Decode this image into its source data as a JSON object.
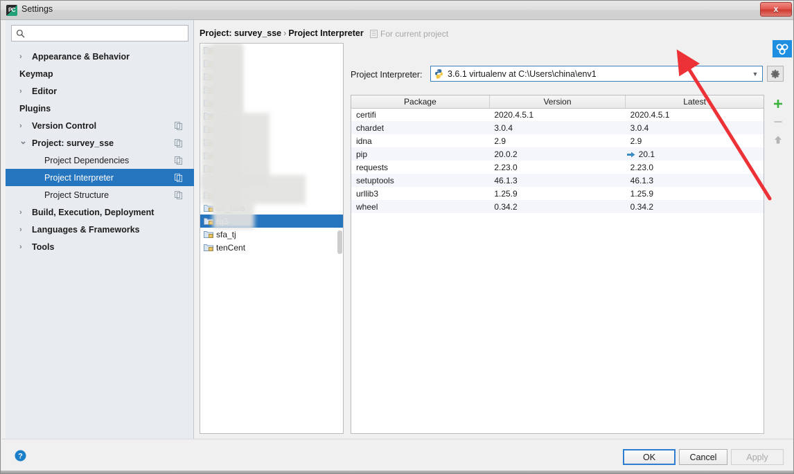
{
  "window": {
    "title": "Settings",
    "app_icon": "pycharm-icon",
    "close_label": "x"
  },
  "sidebar": {
    "search": {
      "value": "",
      "placeholder": ""
    },
    "items": [
      {
        "label": "Appearance & Behavior",
        "level": 0,
        "twisty": "collapsed",
        "copy": false,
        "selected": false
      },
      {
        "label": "Keymap",
        "level": 0,
        "twisty": "none",
        "copy": false,
        "selected": false
      },
      {
        "label": "Editor",
        "level": 0,
        "twisty": "collapsed",
        "copy": false,
        "selected": false
      },
      {
        "label": "Plugins",
        "level": 0,
        "twisty": "none",
        "copy": false,
        "selected": false
      },
      {
        "label": "Version Control",
        "level": 0,
        "twisty": "collapsed",
        "copy": true,
        "selected": false
      },
      {
        "label": "Project: survey_sse",
        "level": 0,
        "twisty": "expanded",
        "copy": true,
        "selected": false
      },
      {
        "label": "Project Dependencies",
        "level": 1,
        "twisty": "none",
        "copy": true,
        "selected": false
      },
      {
        "label": "Project Interpreter",
        "level": 1,
        "twisty": "none",
        "copy": true,
        "selected": true
      },
      {
        "label": "Project Structure",
        "level": 1,
        "twisty": "none",
        "copy": true,
        "selected": false
      },
      {
        "label": "Build, Execution, Deployment",
        "level": 0,
        "twisty": "collapsed",
        "copy": false,
        "selected": false
      },
      {
        "label": "Languages & Frameworks",
        "level": 0,
        "twisty": "collapsed",
        "copy": false,
        "selected": false
      },
      {
        "label": "Tools",
        "level": 0,
        "twisty": "collapsed",
        "copy": false,
        "selected": false
      }
    ]
  },
  "main": {
    "breadcrumb": {
      "root": "Project: survey_sse",
      "separator": "›",
      "leaf": "Project Interpreter"
    },
    "scope_note": {
      "icon": "document-icon",
      "text": "For current project"
    },
    "interpreter": {
      "label": "Project Interpreter:",
      "icon": "python-icon",
      "value": "3.6.1 virtualenv at C:\\Users\\china\\env1",
      "arrow": "chevron-down-icon",
      "gear": "gear-icon"
    },
    "project_list": [
      {
        "label": "",
        "blurred": true,
        "selected": false
      },
      {
        "label": "p",
        "blurred": true,
        "selected": false
      },
      {
        "label": "ect",
        "blurred": true,
        "selected": false
      },
      {
        "label": "d_App",
        "blurred": true,
        "selected": false
      },
      {
        "label": "",
        "blurred": true,
        "selected": false
      },
      {
        "label": "emo",
        "blurred": true,
        "selected": false
      },
      {
        "label": "e",
        "blurred": true,
        "selected": false
      },
      {
        "label": "eb",
        "blurred": true,
        "selected": false
      },
      {
        "label": "rder",
        "blurred": true,
        "selected": false
      },
      {
        "label": "",
        "blurred": true,
        "selected": false
      },
      {
        "label": "n",
        "blurred": true,
        "selected": false
      },
      {
        "label": "_test",
        "blurred": true,
        "selected": false
      },
      {
        "label": "on_utils",
        "blurred": true,
        "selected": false
      },
      {
        "label": "rq3",
        "blurred": false,
        "selected": true
      },
      {
        "label": "sfa_tj",
        "blurred": false,
        "selected": false
      },
      {
        "label": "tenCent",
        "blurred": false,
        "selected": false
      }
    ],
    "packages": {
      "columns": [
        "Package",
        "Version",
        "Latest"
      ],
      "rows": [
        {
          "package": "certifi",
          "version": "2020.4.5.1",
          "latest": "2020.4.5.1",
          "upgradable": false
        },
        {
          "package": "chardet",
          "version": "3.0.4",
          "latest": "3.0.4",
          "upgradable": false
        },
        {
          "package": "idna",
          "version": "2.9",
          "latest": "2.9",
          "upgradable": false
        },
        {
          "package": "pip",
          "version": "20.0.2",
          "latest": "20.1",
          "upgradable": true
        },
        {
          "package": "requests",
          "version": "2.23.0",
          "latest": "2.23.0",
          "upgradable": false
        },
        {
          "package": "setuptools",
          "version": "46.1.3",
          "latest": "46.1.3",
          "upgradable": false
        },
        {
          "package": "urllib3",
          "version": "1.25.9",
          "latest": "1.25.9",
          "upgradable": false
        },
        {
          "package": "wheel",
          "version": "0.34.2",
          "latest": "0.34.2",
          "upgradable": false
        }
      ]
    },
    "tools": [
      {
        "name": "add-package-button",
        "icon": "plus-icon",
        "enabled": true
      },
      {
        "name": "remove-package-button",
        "icon": "minus-icon",
        "enabled": false
      },
      {
        "name": "upgrade-package-button",
        "icon": "arrow-up-icon",
        "enabled": false
      }
    ],
    "badge": "pycharm-badge-icon"
  },
  "footer": {
    "help": "help-icon",
    "ok": "OK",
    "cancel": "Cancel",
    "apply": "Apply"
  },
  "colors": {
    "selection_blue": "#2675bf",
    "focus_blue": "#2d7dd2",
    "annotation_red": "#ed3237",
    "update_arrow_blue": "#3a8ac4",
    "add_green": "#3cb33c"
  }
}
